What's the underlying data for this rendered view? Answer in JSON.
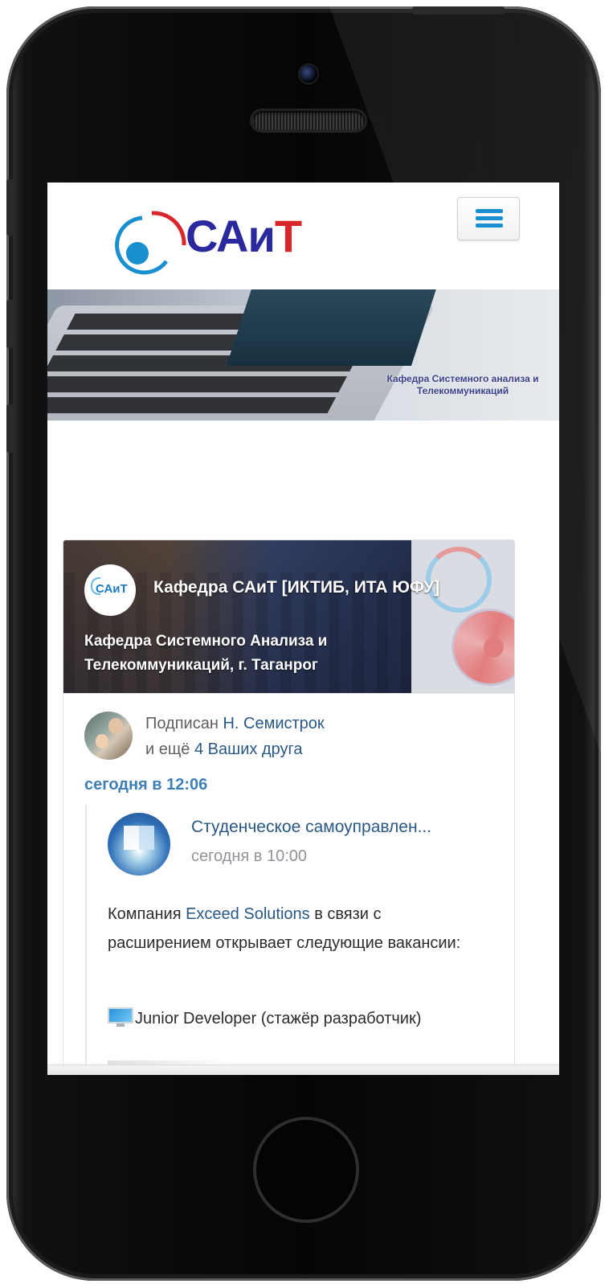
{
  "header": {
    "logo_text": "САи",
    "logo_text_t": "Т",
    "menu_icon": "hamburger-icon",
    "brand_color": "#2a2a9e",
    "accent_color": "#1a8fd0"
  },
  "banner": {
    "caption": "Кафедра Системного анализа и Телекоммуникаций"
  },
  "widget": {
    "avatar_text": "САиТ",
    "title": "Кафедра САиТ [ИКТИБ, ИТА ЮФУ]",
    "description": "Кафедра Системного Анализа и Телекоммуникаций, г. Таганрог",
    "subscribed_prefix": "Подписан ",
    "subscribed_name": "Н. Семистрок",
    "friends_prefix": "и ещё ",
    "friends_link": "4 Ваших друга",
    "post_time": "сегодня в 12:06",
    "repost": {
      "group_name": "Студенческое самоуправлен...",
      "group_time": "сегодня в 10:00",
      "text_prefix": "Компания ",
      "text_link": "Exceed Solutions",
      "text_suffix": " в связи с расширением открывает следующие вакансии:",
      "vacancy": "Junior Developer (стажёр разработчик)"
    },
    "link_color": "#2a5885"
  }
}
